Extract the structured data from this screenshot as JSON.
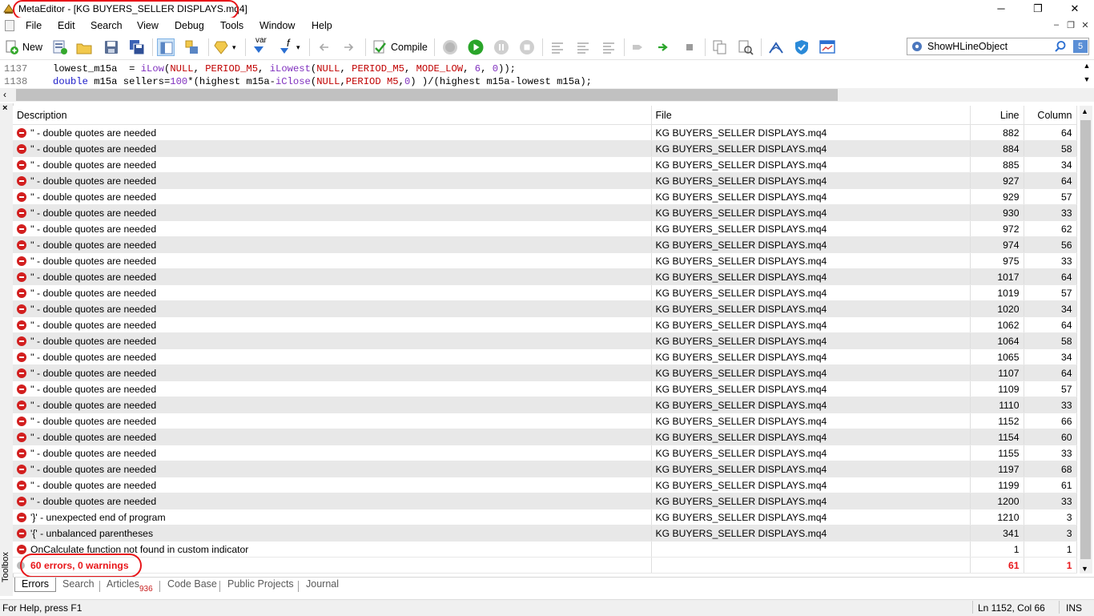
{
  "window": {
    "title": "MetaEditor - [KG BUYERS_SELLER DISPLAYS.mq4]",
    "minimize": "─",
    "restore": "❐",
    "close": "✕"
  },
  "menu": {
    "items": [
      "File",
      "Edit",
      "Search",
      "View",
      "Debug",
      "Tools",
      "Window",
      "Help"
    ],
    "mdi": [
      "–",
      "❐",
      "✕"
    ]
  },
  "toolbar": {
    "new_label": "New",
    "compile_label": "Compile",
    "var_label": "var",
    "f_label": "f"
  },
  "search": {
    "value": "ShowHLineObject",
    "badge": "5"
  },
  "editor": {
    "lines": [
      {
        "num": "1137",
        "text": "lowest_m15a  = iLow(NULL, PERIOD_M5, iLowest(NULL, PERIOD_M5, MODE_LOW, 6, 0));"
      },
      {
        "num": "1138",
        "text": "double m15a sellers=100*(highest m15a-iClose(NULL,PERIOD M5,0) )/(highest m15a-lowest m15a);"
      }
    ]
  },
  "toolbox": {
    "label": "Toolbox",
    "close": "×",
    "columns": {
      "description": "Description",
      "file": "File",
      "line": "Line",
      "column": "Column"
    },
    "rows": [
      {
        "desc": "'' - double quotes are needed",
        "file": "KG BUYERS_SELLER DISPLAYS.mq4",
        "line": "882",
        "col": "64"
      },
      {
        "desc": "'' - double quotes are needed",
        "file": "KG BUYERS_SELLER DISPLAYS.mq4",
        "line": "884",
        "col": "58"
      },
      {
        "desc": "'' - double quotes are needed",
        "file": "KG BUYERS_SELLER DISPLAYS.mq4",
        "line": "885",
        "col": "34"
      },
      {
        "desc": "'' - double quotes are needed",
        "file": "KG BUYERS_SELLER DISPLAYS.mq4",
        "line": "927",
        "col": "64"
      },
      {
        "desc": "'' - double quotes are needed",
        "file": "KG BUYERS_SELLER DISPLAYS.mq4",
        "line": "929",
        "col": "57"
      },
      {
        "desc": "'' - double quotes are needed",
        "file": "KG BUYERS_SELLER DISPLAYS.mq4",
        "line": "930",
        "col": "33"
      },
      {
        "desc": "'' - double quotes are needed",
        "file": "KG BUYERS_SELLER DISPLAYS.mq4",
        "line": "972",
        "col": "62"
      },
      {
        "desc": "'' - double quotes are needed",
        "file": "KG BUYERS_SELLER DISPLAYS.mq4",
        "line": "974",
        "col": "56"
      },
      {
        "desc": "'' - double quotes are needed",
        "file": "KG BUYERS_SELLER DISPLAYS.mq4",
        "line": "975",
        "col": "33"
      },
      {
        "desc": "'' - double quotes are needed",
        "file": "KG BUYERS_SELLER DISPLAYS.mq4",
        "line": "1017",
        "col": "64"
      },
      {
        "desc": "'' - double quotes are needed",
        "file": "KG BUYERS_SELLER DISPLAYS.mq4",
        "line": "1019",
        "col": "57"
      },
      {
        "desc": "'' - double quotes are needed",
        "file": "KG BUYERS_SELLER DISPLAYS.mq4",
        "line": "1020",
        "col": "34"
      },
      {
        "desc": "'' - double quotes are needed",
        "file": "KG BUYERS_SELLER DISPLAYS.mq4",
        "line": "1062",
        "col": "64"
      },
      {
        "desc": "'' - double quotes are needed",
        "file": "KG BUYERS_SELLER DISPLAYS.mq4",
        "line": "1064",
        "col": "58"
      },
      {
        "desc": "'' - double quotes are needed",
        "file": "KG BUYERS_SELLER DISPLAYS.mq4",
        "line": "1065",
        "col": "34"
      },
      {
        "desc": "'' - double quotes are needed",
        "file": "KG BUYERS_SELLER DISPLAYS.mq4",
        "line": "1107",
        "col": "64"
      },
      {
        "desc": "'' - double quotes are needed",
        "file": "KG BUYERS_SELLER DISPLAYS.mq4",
        "line": "1109",
        "col": "57"
      },
      {
        "desc": "'' - double quotes are needed",
        "file": "KG BUYERS_SELLER DISPLAYS.mq4",
        "line": "1110",
        "col": "33"
      },
      {
        "desc": "'' - double quotes are needed",
        "file": "KG BUYERS_SELLER DISPLAYS.mq4",
        "line": "1152",
        "col": "66"
      },
      {
        "desc": "'' - double quotes are needed",
        "file": "KG BUYERS_SELLER DISPLAYS.mq4",
        "line": "1154",
        "col": "60"
      },
      {
        "desc": "'' - double quotes are needed",
        "file": "KG BUYERS_SELLER DISPLAYS.mq4",
        "line": "1155",
        "col": "33"
      },
      {
        "desc": "'' - double quotes are needed",
        "file": "KG BUYERS_SELLER DISPLAYS.mq4",
        "line": "1197",
        "col": "68"
      },
      {
        "desc": "'' - double quotes are needed",
        "file": "KG BUYERS_SELLER DISPLAYS.mq4",
        "line": "1199",
        "col": "61"
      },
      {
        "desc": "'' - double quotes are needed",
        "file": "KG BUYERS_SELLER DISPLAYS.mq4",
        "line": "1200",
        "col": "33"
      },
      {
        "desc": "'}' - unexpected end of program",
        "file": "KG BUYERS_SELLER DISPLAYS.mq4",
        "line": "1210",
        "col": "3"
      },
      {
        "desc": "'{' - unbalanced parentheses",
        "file": "KG BUYERS_SELLER DISPLAYS.mq4",
        "line": "341",
        "col": "3"
      },
      {
        "desc": "OnCalculate function not found in custom indicator",
        "file": "",
        "line": "1",
        "col": "1"
      }
    ],
    "summary": {
      "desc": "60 errors, 0 warnings",
      "line": "61",
      "col": "1"
    }
  },
  "tabs": {
    "items": [
      "Errors",
      "Search",
      "Articles",
      "Code Base",
      "Public Projects",
      "Journal"
    ],
    "active": "Errors",
    "articles_count": "936"
  },
  "status": {
    "help": "For Help, press F1",
    "position": "Ln 1152, Col 66",
    "mode": "INS"
  },
  "colors": {
    "error_red": "#d21f1f",
    "annotation_red": "#e8161a",
    "alt_row": "#e8e8e8"
  }
}
